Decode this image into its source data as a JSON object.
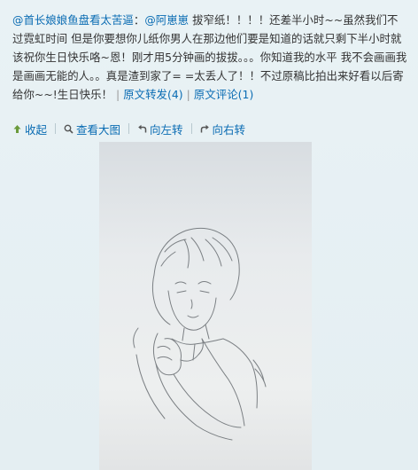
{
  "post": {
    "mention_author": "@首长娘娘鱼盘看太苦逼",
    "colon": "：",
    "mention_target": "@阿崽崽",
    "body": " 拔窄纸！！！！还差半小时~~虽然我们不过霓虹时间 但是你要想你儿纸你男人在那边他们要是知道的话就只剩下半小时就该祝你生日快乐咯~恩！刚才用5分钟画的拔拔。。。你知道我的水平 我不会画画我是画画无能的人。。真是渣到家了= =太丢人了！！不过原稿比拍出来好看以后寄给你~~!生日快乐！",
    "repost_label": "原文转发(4)",
    "comment_label": "原文评论(1)",
    "separator": "|"
  },
  "toolbar": {
    "collapse": "收起",
    "view_large": "查看大图",
    "rotate_left": "向左转",
    "rotate_right": "向右转"
  },
  "colors": {
    "link": "#0a6cb3",
    "background": "#e6f0f3",
    "text": "#333333"
  },
  "icons": {
    "collapse": "arrow-up-icon",
    "view_large": "magnifier-icon",
    "rotate_left": "rotate-left-icon",
    "rotate_right": "rotate-right-icon"
  }
}
